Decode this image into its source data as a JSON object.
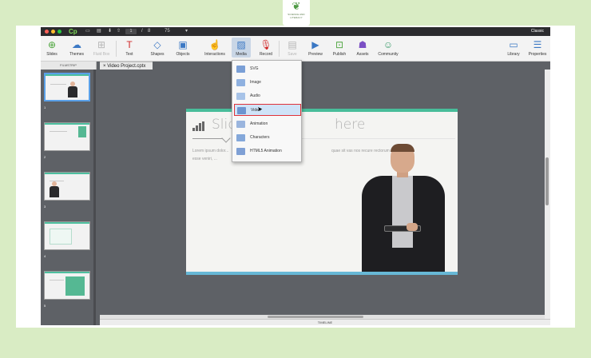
{
  "branding": {
    "logo_line1": "SCIENCE AND",
    "logo_line2": "LITERACY"
  },
  "titlebar": {
    "app_icon": "Cp",
    "page_current": "1",
    "page_sep": "/",
    "page_total": "8",
    "zoom": "75",
    "mode": "Classic"
  },
  "toolbar": {
    "slides": "Slides",
    "themes": "Themes",
    "fluid_box": "Fluid Box",
    "text": "Text",
    "shapes": "Shapes",
    "objects": "Objects",
    "interactions": "Interactions",
    "media": "Media",
    "record": "Record",
    "save": "Save",
    "preview": "Preview",
    "publish": "Publish",
    "assets": "Assets",
    "community": "Community",
    "library": "Library",
    "properties": "Properties"
  },
  "filmstrip": {
    "header": "FILMSTRIP",
    "slide_numbers": [
      "1",
      "2",
      "3",
      "4",
      "5"
    ]
  },
  "document_tab": {
    "close": "×",
    "name": "Video Project.cptx"
  },
  "slide": {
    "title_left": "Slid",
    "title_right": "here",
    "body_line1": "Lorem ipsum dolor...",
    "body_line2": "esse veniri, ...",
    "body_right": "quae sit vas nos recure rectorum"
  },
  "media_menu": {
    "items": [
      "SVG",
      "Image",
      "Audio",
      "Video",
      "Animation",
      "Characters",
      "HTML5 Animation"
    ],
    "highlighted": "Video"
  },
  "bottom": {
    "timeline": "TIMELINE"
  },
  "colors": {
    "background": "#d9ecc4",
    "teal": "#48bd9a",
    "highlight_border": "#e0333a"
  }
}
